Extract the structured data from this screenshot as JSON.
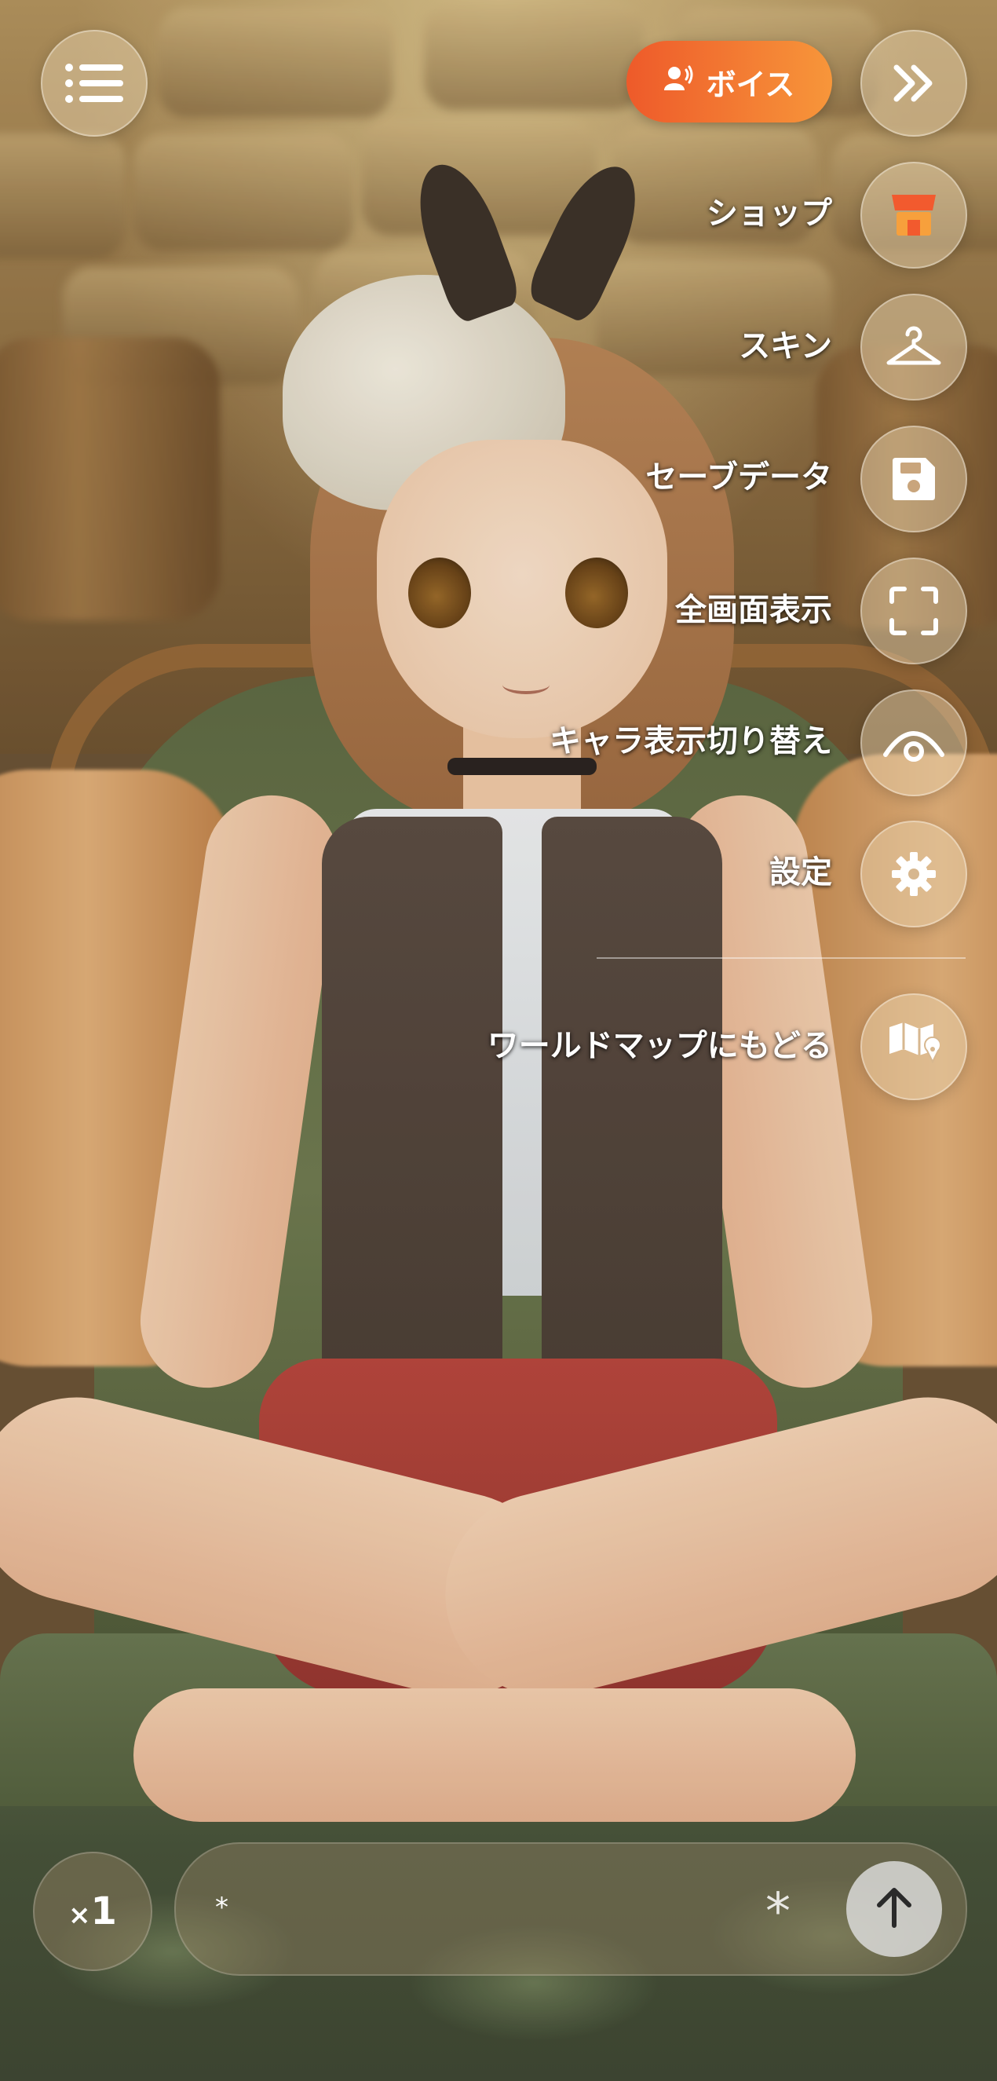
{
  "header": {
    "menu_icon": "list-menu-icon",
    "voice_button": {
      "label": "ボイス",
      "icon": "voice-person-icon",
      "colors": [
        "#ee5a2a",
        "#f7963a"
      ]
    },
    "collapse_icon": "double-chevron-right-icon"
  },
  "side_menu": {
    "items": [
      {
        "label": "ショップ",
        "icon": "shop-icon"
      },
      {
        "label": "スキン",
        "icon": "hanger-icon"
      },
      {
        "label": "セーブデータ",
        "icon": "save-disk-icon"
      },
      {
        "label": "全画面表示",
        "icon": "fullscreen-icon"
      },
      {
        "label": "キャラ表示切り替え",
        "icon": "eye-icon"
      },
      {
        "label": "設定",
        "icon": "gear-icon"
      },
      {
        "label": "ワールドマップにもどる",
        "icon": "map-pin-icon"
      }
    ]
  },
  "bottom_bar": {
    "speed": {
      "prefix": "×",
      "value": "1"
    },
    "input": {
      "value": "*"
    },
    "asterisk_label": "*",
    "send_icon": "arrow-up-icon"
  }
}
